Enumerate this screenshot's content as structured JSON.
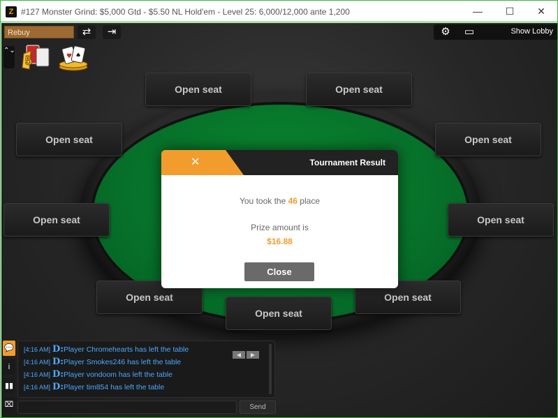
{
  "window": {
    "logo": "Z",
    "title": "#127 Monster Grind: $5,000 Gtd - $5.50 NL Hold'em - Level 25: 6,000/12,000 ante 1,200",
    "minimize": "—",
    "maximize": "☐",
    "close": "✕"
  },
  "toolbar": {
    "rebuy_label": "Rebuy",
    "refresh_icon": "⇄",
    "exit_icon": "⇥",
    "settings_icon": "⚙",
    "layout_icon": "▭",
    "show_lobby_label": "Show Lobby",
    "updown_icon": "⌃⌄"
  },
  "seats": [
    "Open seat",
    "Open seat",
    "Open seat",
    "Open seat",
    "Open seat",
    "Open seat",
    "Open seat",
    "Open seat",
    "Open seat"
  ],
  "modal": {
    "close_icon": "✕",
    "title": "Tournament Result",
    "took_prefix": "You took the ",
    "place_number": "46",
    "took_suffix": " place",
    "prize_label": "Prize amount is",
    "prize_value": "$16.88",
    "close_button": "Close"
  },
  "chat": {
    "lines": [
      {
        "time": "[4:16 AM]",
        "marker": "D:",
        "text": "Player Chromehearts  has left the table"
      },
      {
        "time": "[4:16 AM]",
        "marker": "D:",
        "text": "Player Smokes246  has left the table"
      },
      {
        "time": "[4:16 AM]",
        "marker": "D:",
        "text": "Player vondoom  has left the table"
      },
      {
        "time": "[4:16 AM]",
        "marker": "D:",
        "text": "Player tim854  has left the table"
      }
    ],
    "prev_icon": "◀",
    "next_icon": "▶",
    "input_placeholder": "",
    "send_label": "Send",
    "side_tabs": [
      "💬",
      "i",
      "▮▮",
      "⌧"
    ]
  },
  "colors": {
    "accent": "#f39c2e",
    "felt": "#06702a",
    "chat_text": "#4aa8ff",
    "frame": "#2fbf2f"
  }
}
